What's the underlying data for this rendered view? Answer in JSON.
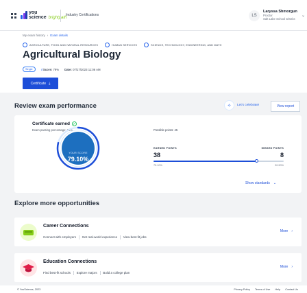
{
  "header": {
    "logo_word": "you",
    "logo_word2": "science",
    "logo_sub": "brightpath",
    "product": "Industry Certifications",
    "user": {
      "initials": "LS",
      "name": "Laryssa Shmorgun",
      "role": "Proctor",
      "org": "Salt Lake School District"
    }
  },
  "breadcrumb": {
    "root": "My exam history",
    "current": "Exam details"
  },
  "exam": {
    "clusters": [
      "AGRICULTURE, FOOD AND NATURAL RESOURCES",
      "HUMAN SERVICES",
      "SCIENCE, TECHNOLOGY, ENGINEERING, AND MATH"
    ],
    "title": "Agricultural Biology",
    "attempt": "Single",
    "score_label": "Score:",
    "score_value": "79%",
    "date_label": "Date:",
    "date_value": "07/17/2023 11:06 AM",
    "cert_button": "Certificate"
  },
  "review": {
    "title": "Review exam performance",
    "celebrate": "Let's celebrate!",
    "view_report": "View report",
    "cert_earned": "Certificate earned",
    "pass_pct": "Exam passing percentage: 75%",
    "score_caption": "YOUR SCORE",
    "score": "79.10%",
    "score_fraction": 0.791,
    "possible_points": "Possible points: 45",
    "earned_label": "EARNED POINTS",
    "earned_value": "38",
    "earned_pct": "79.10%",
    "missed_label": "MISSED POINTS",
    "missed_value": "8",
    "missed_pct": "20.90%",
    "show_standards": "Show standards"
  },
  "explore": {
    "title": "Explore more opportunities",
    "cards": [
      {
        "title": "Career Connections",
        "links": [
          "Connect with employers",
          "Get real-world experience",
          "View best-fit jobs"
        ],
        "more": "More",
        "icon_color": "#84cc16",
        "icon_bg": "#ecfccb"
      },
      {
        "title": "Education Connections",
        "links": [
          "Find best-fit schools",
          "Explore majors",
          "Build a college plan"
        ],
        "more": "More",
        "icon_color": "#e11d48",
        "icon_bg": "#ffe4e6"
      }
    ]
  },
  "footer": {
    "copyright": "© YouScience, 2023",
    "links": [
      "Privacy Policy",
      "Terms of Use",
      "Help",
      "Contact Us"
    ]
  },
  "colors": {
    "primary": "#1d4ed8",
    "success": "#22c55e"
  }
}
